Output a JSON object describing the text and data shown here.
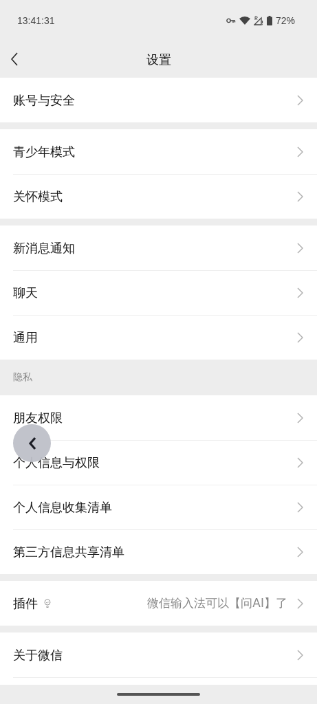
{
  "status_bar": {
    "time": "13:41:31",
    "battery": "72%"
  },
  "header": {
    "title": "设置"
  },
  "sections": [
    {
      "items": [
        {
          "kind": "link",
          "label": "账号与安全"
        }
      ]
    },
    {
      "items": [
        {
          "kind": "link",
          "label": "青少年模式"
        },
        {
          "kind": "link",
          "label": "关怀模式"
        }
      ]
    },
    {
      "items": [
        {
          "kind": "link",
          "label": "新消息通知"
        },
        {
          "kind": "link",
          "label": "聊天"
        },
        {
          "kind": "link",
          "label": "通用"
        }
      ]
    },
    {
      "title": "隐私",
      "items": [
        {
          "kind": "link",
          "label": "朋友权限"
        },
        {
          "kind": "link",
          "label": "个人信息与权限"
        },
        {
          "kind": "link",
          "label": "个人信息收集清单"
        },
        {
          "kind": "link",
          "label": "第三方信息共享清单"
        }
      ]
    },
    {
      "items": [
        {
          "kind": "plugin",
          "label": "插件",
          "value": "微信输入法可以【问AI】了"
        }
      ]
    },
    {
      "items": [
        {
          "kind": "link",
          "label": "关于微信"
        }
      ],
      "trailing": true
    }
  ]
}
